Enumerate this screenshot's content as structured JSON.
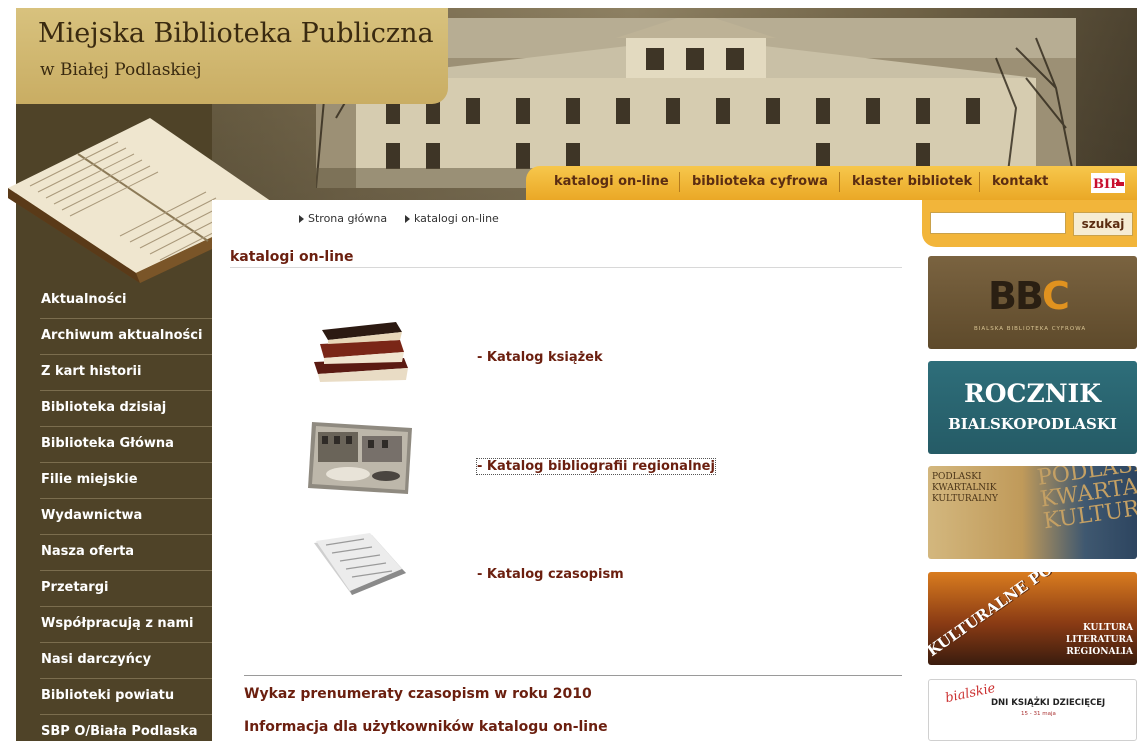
{
  "header": {
    "title": "Miejska Biblioteka Publiczna",
    "subtitle": "w Białej Podlaskiej"
  },
  "topnav": {
    "items": [
      {
        "label": "katalogi on-line"
      },
      {
        "label": "biblioteka cyfrowa"
      },
      {
        "label": "klaster bibliotek"
      },
      {
        "label": "kontakt"
      }
    ],
    "bip_logo": "BIP"
  },
  "search": {
    "placeholder": "",
    "value": "",
    "button_label": "szukaj"
  },
  "breadcrumb": [
    {
      "label": "Strona główna"
    },
    {
      "label": "katalogi on-line"
    }
  ],
  "sidebar": {
    "items": [
      {
        "label": "Aktualności"
      },
      {
        "label": "Archiwum aktualności"
      },
      {
        "label": "Z kart historii"
      },
      {
        "label": "Biblioteka dzisiaj"
      },
      {
        "label": "Biblioteka Główna"
      },
      {
        "label": "Filie miejskie"
      },
      {
        "label": "Wydawnictwa"
      },
      {
        "label": "Nasza oferta"
      },
      {
        "label": "Przetargi"
      },
      {
        "label": "Współpracują z nami"
      },
      {
        "label": "Nasi darczyńcy"
      },
      {
        "label": "Biblioteki powiatu"
      },
      {
        "label": "SBP O/Biała Podlaska"
      }
    ]
  },
  "main": {
    "heading": "katalogi on-line",
    "catalogs": [
      {
        "label": "- Katalog książek",
        "icon": "books-stack-icon"
      },
      {
        "label": "- Katalog bibliografii regionalnej",
        "icon": "old-street-photo-icon"
      },
      {
        "label": "- Katalog czasopism",
        "icon": "newspaper-icon"
      }
    ],
    "bottom_links": [
      {
        "label": "Wykaz prenumeraty czasopism w roku 2010"
      },
      {
        "label": "Informacja dla użytkowników katalogu on-line"
      }
    ]
  },
  "banners": {
    "bbc": {
      "logo_b": "BB",
      "logo_c": "C",
      "sub": "BIALSKA BIBLIOTEKA CYFROWA"
    },
    "rocznik": {
      "line1": "ROCZNIK",
      "line2": "BIALSKOPODLASKI"
    },
    "pkk": {
      "line1": "PODLASKI",
      "line2": "KWARTALNIK",
      "line3": "KULTURALNY",
      "big": "PODLASKI KWARTALNIK KULTURALNY"
    },
    "kult": {
      "arc": "KULTURALNE PODLASIE",
      "line1": "KULTURA",
      "line2": "LITERATURA",
      "line3": "REGIONALIA"
    },
    "dni": {
      "script": "bialskie",
      "title": "DNI KSIĄŻKI DZIECIĘCEJ",
      "dates": "15 - 31 maja"
    }
  },
  "colors": {
    "accent": "#f2b53a",
    "sidebar": "#4f4328",
    "link": "#6b1f0f"
  }
}
